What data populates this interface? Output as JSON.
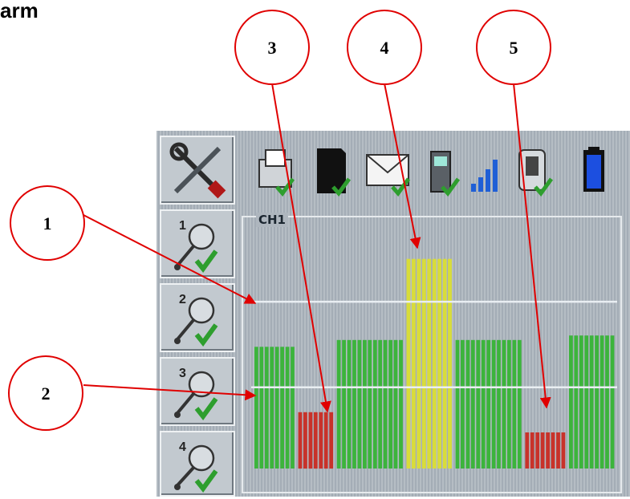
{
  "page_title": "arm",
  "channel_label": "CH1",
  "side_buttons": [
    {
      "number": "",
      "icon": "tools-icon"
    },
    {
      "number": "1",
      "icon": "probe-check-icon"
    },
    {
      "number": "2",
      "icon": "probe-check-icon"
    },
    {
      "number": "3",
      "icon": "probe-check-icon"
    },
    {
      "number": "4",
      "icon": "probe-check-icon"
    }
  ],
  "status_icons": [
    "printer-icon",
    "sd-card-icon",
    "email-icon",
    "modem-icon",
    "signal-bars-icon",
    "power-plug-icon",
    "battery-icon"
  ],
  "callouts": [
    "1",
    "2",
    "3",
    "4",
    "5"
  ],
  "colors": {
    "ok": "#3cb43c",
    "alarm": "#c8322a",
    "warning": "#d8dc3a",
    "arrow": "#e00000"
  },
  "chart_data": {
    "type": "bar",
    "threshold_upper_fraction": 0.74,
    "threshold_lower_fraction": 0.36,
    "segments": [
      {
        "count": 8,
        "level": 0.54,
        "status": "ok"
      },
      {
        "count": 7,
        "level": 0.25,
        "status": "alarm"
      },
      {
        "count": 13,
        "level": 0.57,
        "status": "ok"
      },
      {
        "count": 9,
        "level": 0.93,
        "status": "warning"
      },
      {
        "count": 13,
        "level": 0.57,
        "status": "ok"
      },
      {
        "count": 8,
        "level": 0.16,
        "status": "alarm"
      },
      {
        "count": 9,
        "level": 0.59,
        "status": "ok"
      }
    ]
  }
}
